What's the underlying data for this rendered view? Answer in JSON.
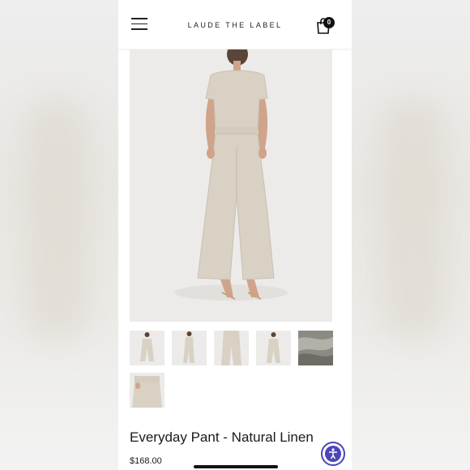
{
  "header": {
    "brand": "LAUDE THE LABEL",
    "cart_count": "0",
    "menu_icon": "hamburger-menu-icon",
    "cart_icon": "shopping-bag-icon"
  },
  "product": {
    "title": "Everyday Pant - Natural Linen",
    "price": "$168.00",
    "thumbnails": [
      "front-view",
      "side-view",
      "detail-view",
      "back-view",
      "fabric-swatch",
      "waist-detail"
    ]
  },
  "accessibility": {
    "icon": "accessibility-icon"
  },
  "colors": {
    "linen": "#d8d1c4",
    "accent": "#4b45b8",
    "text": "#1a1a1a"
  }
}
